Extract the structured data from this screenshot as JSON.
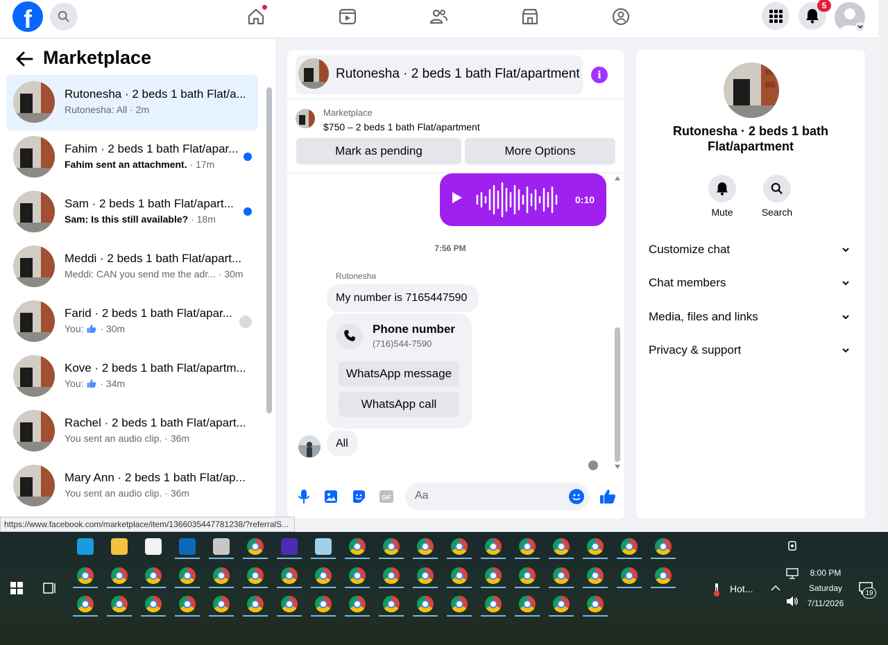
{
  "top_nav": {
    "logo": "f",
    "notification_count": "5",
    "icons": [
      "search-icon",
      "home-icon",
      "video-icon",
      "friends-icon",
      "marketplace-icon",
      "groups-icon",
      "menu-grid-icon",
      "bell-icon",
      "profile-avatar"
    ]
  },
  "sidebar": {
    "title": "Marketplace",
    "conversations": [
      {
        "name": "Rutonesha · 2 beds 1 bath Flat/a...",
        "preview": "Rutonesha: All",
        "time": "2m",
        "unread": false,
        "active": true
      },
      {
        "name": "Fahim · 2 beds 1 bath Flat/apar...",
        "preview": "Fahim sent an attachment.",
        "time": "17m",
        "unread": true,
        "active": false
      },
      {
        "name": "Sam · 2 beds 1 bath Flat/apart...",
        "preview": "Sam: Is this still available?",
        "time": "18m",
        "unread": true,
        "active": false
      },
      {
        "name": "Meddi · 2 beds 1 bath Flat/apart...",
        "preview": "Meddi: CAN you send me the adr...",
        "time": "30m",
        "unread": false,
        "active": false
      },
      {
        "name": "Farid · 2 beds 1 bath Flat/apar...",
        "preview": "You:",
        "time": "30m",
        "unread": false,
        "active": false
      },
      {
        "name": "Kove · 2 beds 1 bath Flat/apartm...",
        "preview": "You:",
        "time": "34m",
        "unread": false,
        "active": false
      },
      {
        "name": "Rachel · 2 beds 1 bath Flat/apart...",
        "preview": "You sent an audio clip.",
        "time": "36m",
        "unread": false,
        "active": false
      },
      {
        "name": "Mary Ann · 2 beds 1 bath Flat/ap...",
        "preview": "You sent an audio clip.",
        "time": "36m",
        "unread": false,
        "active": false
      }
    ]
  },
  "chat": {
    "header_title": "Rutonesha · 2 beds 1 bath Flat/apartment",
    "listing_label": "Marketplace",
    "listing_price": "$750 – 2 beds 1 bath Flat/apartment",
    "mark_pending_label": "Mark as pending",
    "more_options_label": "More Options",
    "audio_duration": "0:10",
    "timestamp": "7:56 PM",
    "sender_name": "Rutonesha",
    "message_1": "My number is 7165447590",
    "phone_card_title": "Phone number",
    "phone_card_number": "(716)544-7590",
    "whatsapp_message_label": "WhatsApp message",
    "whatsapp_call_label": "WhatsApp call",
    "message_2": "All",
    "composer_placeholder": "Aa"
  },
  "info_panel": {
    "title": "Rutonesha · 2 beds 1 bath Flat/apartment",
    "mute_label": "Mute",
    "search_label": "Search",
    "sections": [
      "Customize chat",
      "Chat members",
      "Media, files and links",
      "Privacy & support"
    ]
  },
  "status_url": "https://www.facebook.com/marketplace/item/1366035447781238/?referralS...",
  "taskbar": {
    "weather": "Hot...",
    "time": "8:00 PM",
    "day": "Saturday",
    "date": "7/11/2026",
    "notif_count": "19"
  },
  "colors": {
    "accent": "#0866ff",
    "audio": "#a020f0",
    "info": "#a033ff"
  }
}
